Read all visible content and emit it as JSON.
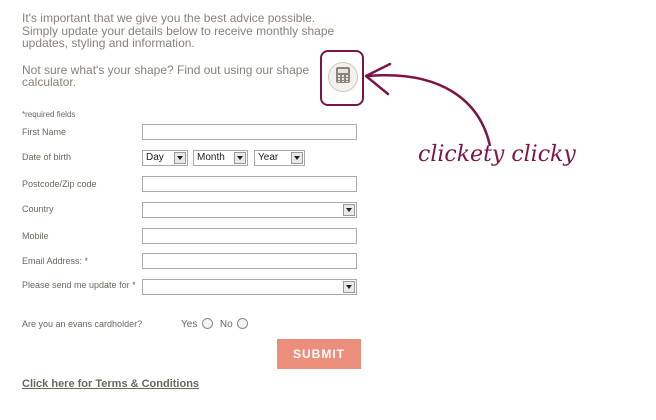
{
  "intro": {
    "paragraph1": "It's important that we give you the best advice possible. Simply update your details below to receive monthly shape updates, styling and information.",
    "paragraph2": "Not sure what's your shape? Find out using our shape calculator."
  },
  "calculator": {
    "icon": "calculator-icon"
  },
  "form": {
    "required_note": "*required fields",
    "first_name_label": "First Name",
    "first_name_value": "",
    "dob_label": "Date of birth",
    "dob_day": "Day",
    "dob_month": "Month",
    "dob_year": "Year",
    "postcode_label": "Postcode/Zip code",
    "postcode_value": "",
    "country_label": "Country",
    "country_value": "",
    "mobile_label": "Mobile",
    "mobile_value": "",
    "email_label": "Email Address: *",
    "email_value": "",
    "update_label": "Please send me update for *",
    "update_value": "",
    "cardholder_label": "Are you an evans cardholder?",
    "yes_label": "Yes",
    "no_label": "No",
    "submit_label": "SUBMIT",
    "terms_link": "Click here for Terms & Conditions"
  },
  "annotation": {
    "text": "clickety clicky",
    "color": "#7d1448"
  },
  "colors": {
    "accent": "#eb8e7b",
    "annotation": "#7d1448"
  }
}
